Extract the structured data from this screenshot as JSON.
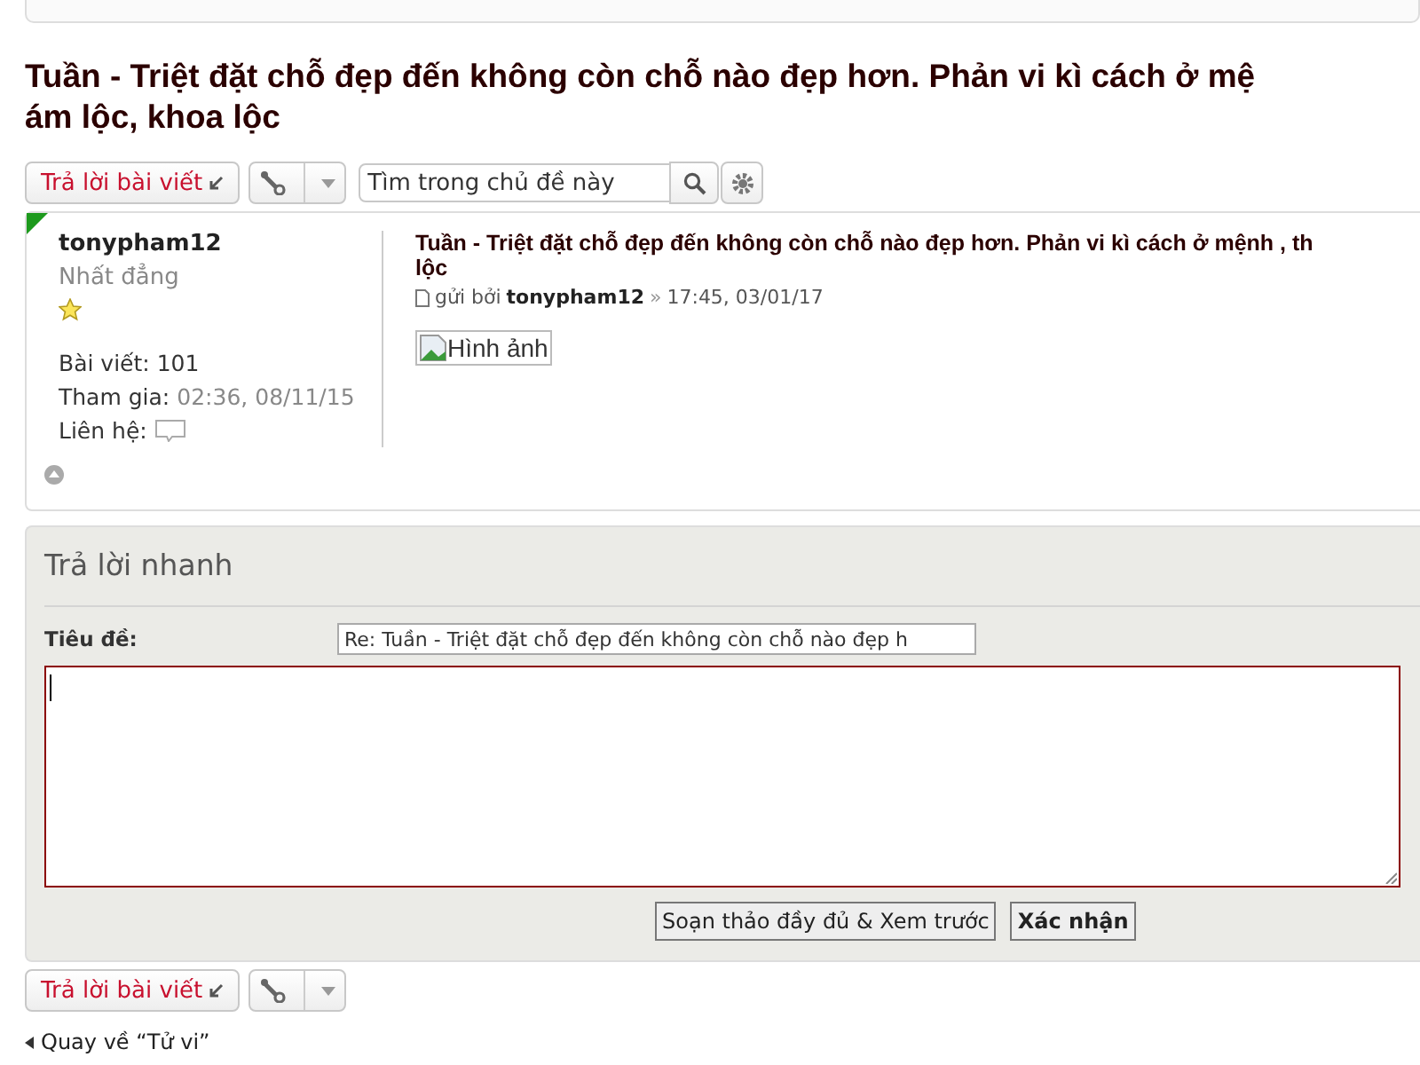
{
  "title_lines": [
    "Tuần - Triệt đặt chỗ đẹp đến không còn chỗ nào đẹp hơn. Phản vi kì cách ở mệ",
    "ám lộc, khoa lộc"
  ],
  "toolbar": {
    "reply_button": "Trả lời bài viết",
    "search": {
      "placeholder": "Tìm trong chủ đề này"
    }
  },
  "post": {
    "author": "tonypham12",
    "rank": "Nhất đẳng",
    "online": true,
    "stats": [
      {
        "label": "Bài viết:",
        "value": "101",
        "kind": "plain"
      },
      {
        "label": "Tham gia:",
        "value": "02:36, 08/11/15",
        "kind": "muted"
      },
      {
        "label": "Liên hệ:",
        "kind": "contact"
      }
    ],
    "subject_lines": [
      "Tuần - Triệt đặt chỗ đẹp đến không còn chỗ nào đẹp hơn. Phản vi kì cách ở mệnh , th",
      "lộc"
    ],
    "byline": {
      "prefix": "gửi bởi",
      "author": "tonypham12",
      "sep": "»",
      "time": "17:45, 03/01/17"
    },
    "image_alt": "Hình ảnh"
  },
  "quick_reply": {
    "heading": "Trả lời nhanh",
    "subject_label": "Tiêu đề:",
    "subject_value": "Re: Tuần - Triệt đặt chỗ đẹp đến không còn chỗ nào đẹp h",
    "buttons": [
      {
        "label": "Soạn thảo đầy đủ & Xem trước",
        "kind": "secondary"
      },
      {
        "label": "Xác nhận",
        "kind": "primary"
      }
    ]
  },
  "bottom_toolbar": {
    "reply_button": "Trả lời bài viết"
  },
  "back_link": "Quay về “Tử vi”"
}
